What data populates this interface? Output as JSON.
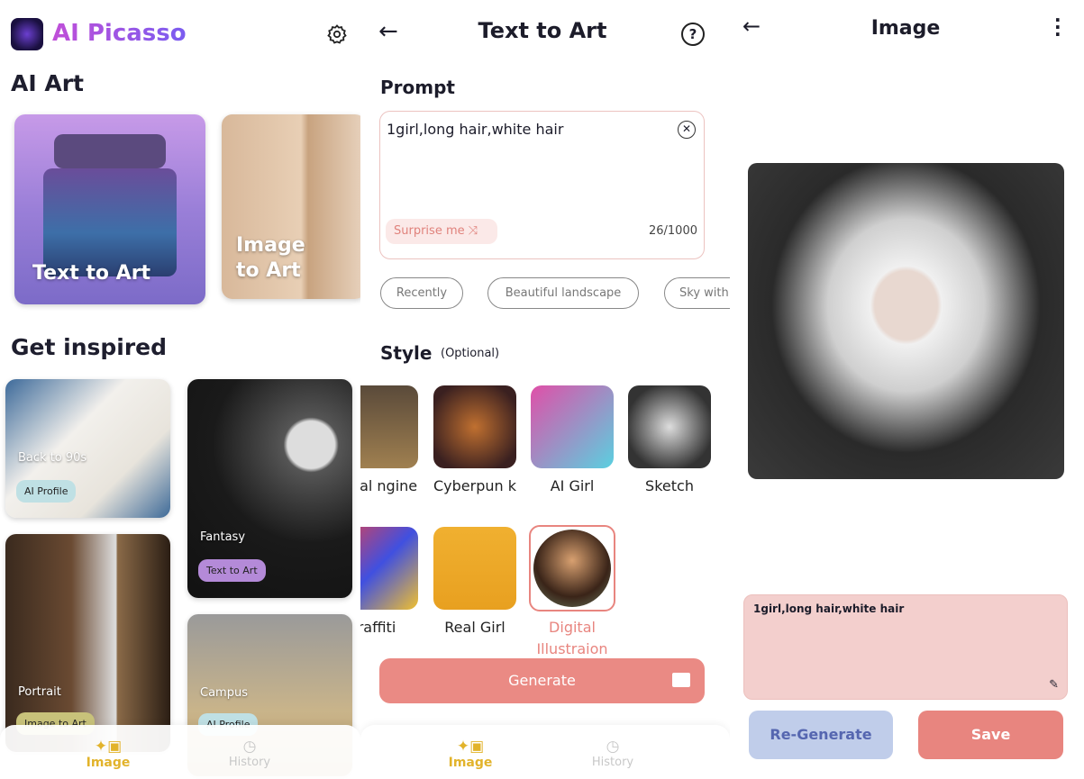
{
  "home": {
    "app_title": "AI Picasso",
    "section_ai_art": "AI Art",
    "feature_cards": [
      {
        "label": "Text to Art"
      },
      {
        "label": "Image to Art"
      }
    ],
    "section_inspired": "Get inspired",
    "inspired": [
      {
        "title": "Back to 90s",
        "badge": "AI Profile"
      },
      {
        "title": "Fantasy",
        "badge": "Text to Art"
      },
      {
        "title": "Portrait",
        "badge": "Image to Art"
      },
      {
        "title": "Campus",
        "badge": "AI Profile"
      }
    ],
    "nav": [
      {
        "label": "Image",
        "active": true
      },
      {
        "label": "History",
        "active": false
      }
    ]
  },
  "text_to_art": {
    "title": "Text to Art",
    "prompt_label": "Prompt",
    "prompt_value": "1girl,long hair,white hair",
    "surprise_label": "Surprise me",
    "counter": "26/1000",
    "chips": [
      "Recently",
      "Beautiful landscape",
      "Sky with"
    ],
    "style_label": "Style",
    "style_optional": "(Optional)",
    "styles": [
      {
        "label": "nreal ngine"
      },
      {
        "label": "Cyberpun k"
      },
      {
        "label": "AI Girl"
      },
      {
        "label": "Sketch"
      },
      {
        "label": "raffiti"
      },
      {
        "label": "Real Girl"
      },
      {
        "label": "Digital Illustraion",
        "selected": true
      }
    ],
    "generate_label": "Generate",
    "nav": [
      {
        "label": "Image",
        "active": true
      },
      {
        "label": "History",
        "active": false
      }
    ]
  },
  "result": {
    "title": "Image",
    "prompt": "1girl,long hair,white hair",
    "regenerate_label": "Re-Generate",
    "save_label": "Save"
  },
  "colors": {
    "accent": "#e8857f",
    "active_nav": "#e2b32b",
    "brand_purple": "#9b5de5",
    "regen_bg": "#c0cdea",
    "regen_text": "#5566b0",
    "prompt_bg": "#f3cfcd"
  }
}
